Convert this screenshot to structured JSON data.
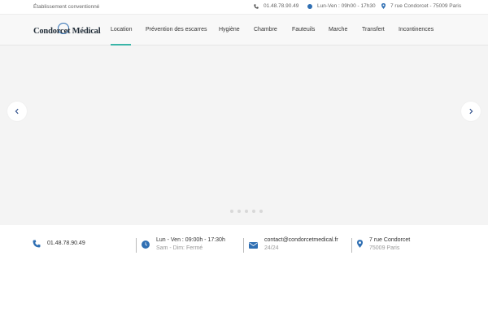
{
  "topbar": {
    "left_text": "Établissement conventionné",
    "phone": "01.48.78.90.49",
    "hours": "Lun-Ven : 09h00 - 17h30",
    "address": "7 rue Condorcet - 75009 Paris"
  },
  "logo": {
    "text": "Condorcet Médical"
  },
  "menu": {
    "items": [
      "Location",
      "Prévention des escarres",
      "Hygiène",
      "Chambre",
      "Fauteuils",
      "Marche",
      "Transfert",
      "Incontinences"
    ],
    "active": "Location"
  },
  "slider": {
    "prev_icon": "chevron-left-icon",
    "next_icon": "chevron-right-icon",
    "dot_count": 5
  },
  "info": {
    "phone": {
      "main": "01.48.78.90.49"
    },
    "hours": {
      "main": "Lun - Ven : 09:00h - 17:30h",
      "sub": "Sam - Dim: Fermé"
    },
    "email": {
      "main": "contact@condorcetmedical.fr",
      "sub": "24/24"
    },
    "address": {
      "main": "7 rue Condorcet",
      "sub": "75009 Paris"
    }
  },
  "colors": {
    "accent": "#3ab5a8",
    "icon_blue": "#2f6fb3",
    "slider_bg": "#f4f4f4"
  }
}
